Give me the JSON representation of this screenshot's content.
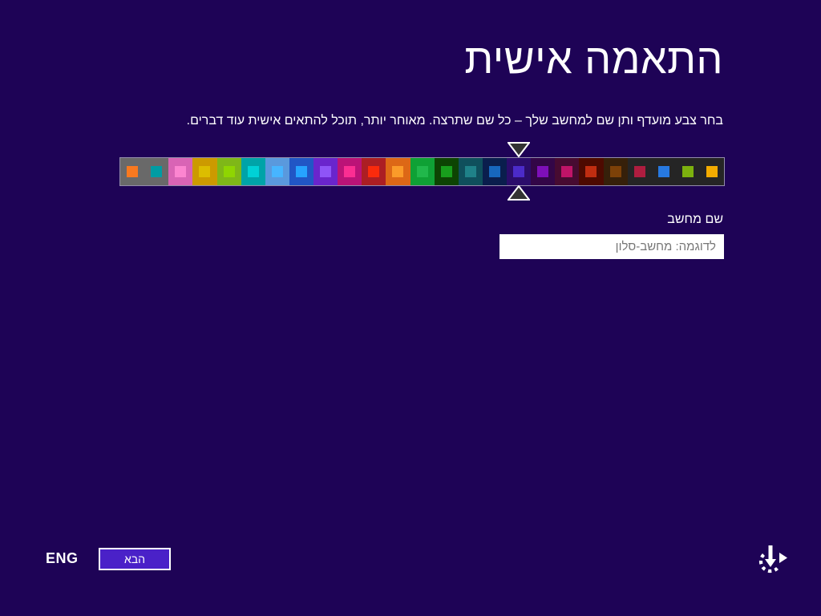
{
  "page": {
    "title": "התאמה אישית",
    "subtitle": "בחר צבע מועדף ותן שם למחשב שלך – כל שם שתרצה. מאוחר יותר, תוכל להתאים אישית עוד דברים.",
    "background": "#1e0356"
  },
  "color_picker": {
    "selected_index": 16,
    "marker_fill": "#333333",
    "marker_stroke": "#ffffff",
    "border_color": "#938cab",
    "cells": [
      {
        "bg": "#696969",
        "accent": "#f8791f"
      },
      {
        "bg": "#696969",
        "accent": "#009ca3"
      },
      {
        "bg": "#d964b5",
        "accent": "#fc85d0"
      },
      {
        "bg": "#cc9a00",
        "accent": "#dcbd00"
      },
      {
        "bg": "#7fb718",
        "accent": "#8fd502"
      },
      {
        "bg": "#00a3a8",
        "accent": "#00d1d6"
      },
      {
        "bg": "#5a99dd",
        "accent": "#47b5ff"
      },
      {
        "bg": "#2156c5",
        "accent": "#26a3ff"
      },
      {
        "bg": "#6a25cc",
        "accent": "#8f54f7"
      },
      {
        "bg": "#bb1377",
        "accent": "#fb2e92"
      },
      {
        "bg": "#ac1e23",
        "accent": "#fa2b0c"
      },
      {
        "bg": "#dd6816",
        "accent": "#fb9b29"
      },
      {
        "bg": "#0fa135",
        "accent": "#21b84b"
      },
      {
        "bg": "#0d4403",
        "accent": "#189e1c"
      },
      {
        "bg": "#0f4f5c",
        "accent": "#1f8188"
      },
      {
        "bg": "#0a1e4d",
        "accent": "#1767bd"
      },
      {
        "bg": "#2b0d6b",
        "accent": "#4b2bc9"
      },
      {
        "bg": "#330647",
        "accent": "#7e0fb8"
      },
      {
        "bg": "#470b31",
        "accent": "#c01468"
      },
      {
        "bg": "#4d0a00",
        "accent": "#bf2d10"
      },
      {
        "bg": "#36200a",
        "accent": "#7d4108"
      },
      {
        "bg": "#252525",
        "accent": "#ae1d3f"
      },
      {
        "bg": "#252525",
        "accent": "#2779e0"
      },
      {
        "bg": "#252525",
        "accent": "#7cb10e"
      },
      {
        "bg": "#252525",
        "accent": "#f2ab00"
      }
    ]
  },
  "computer_name": {
    "label": "שם מחשב",
    "placeholder": "לדוגמה: מחשב-סלון",
    "value": ""
  },
  "footer": {
    "language": "ENG",
    "next_label": "הבא",
    "next_button_color": "#4a21c8"
  }
}
